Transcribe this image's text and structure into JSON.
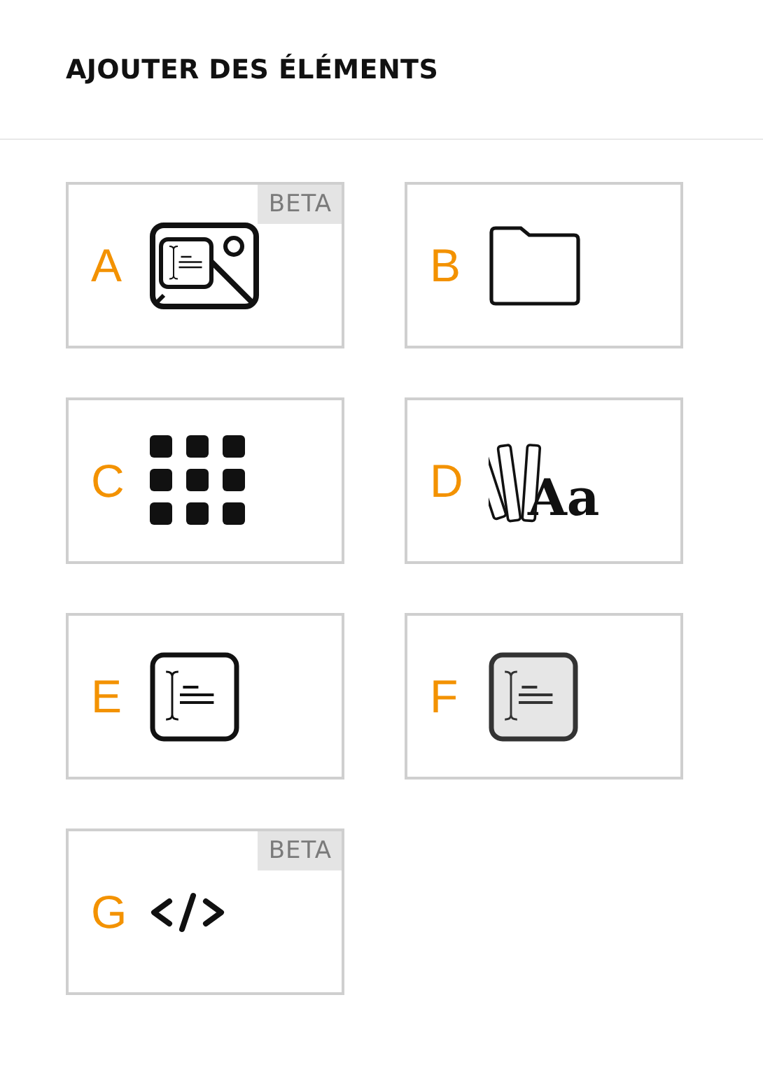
{
  "header": {
    "title": "AJOUTER DES ÉLÉMENTS"
  },
  "elements": [
    {
      "letter": "A",
      "kind": "image-text",
      "badge": "BETA"
    },
    {
      "letter": "B",
      "kind": "folder"
    },
    {
      "letter": "C",
      "kind": "grid"
    },
    {
      "letter": "D",
      "kind": "swatch-text",
      "icon_text": "Aa"
    },
    {
      "letter": "E",
      "kind": "text-box"
    },
    {
      "letter": "F",
      "kind": "text-box-filled"
    },
    {
      "letter": "G",
      "kind": "code",
      "badge": "BETA"
    }
  ]
}
